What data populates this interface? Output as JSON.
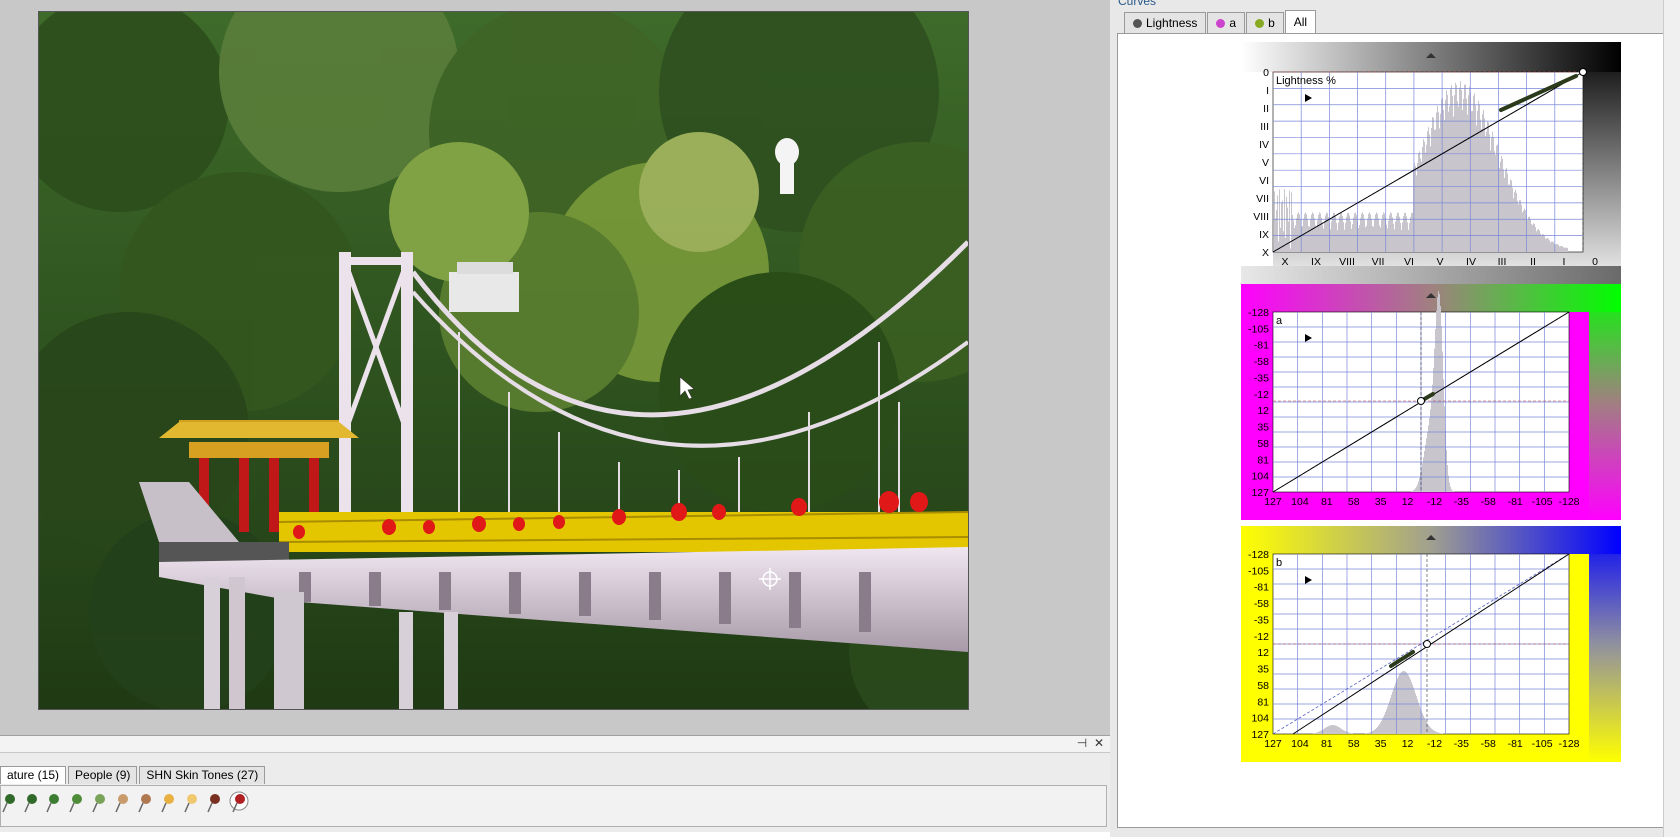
{
  "curves_panel": {
    "title": "Curves",
    "tabs": [
      {
        "label": "Lightness",
        "dot_color": "#555555",
        "active": false
      },
      {
        "label": "a",
        "dot_color": "#cc44cc",
        "active": false
      },
      {
        "label": "b",
        "dot_color": "#88aa22",
        "active": false
      },
      {
        "label": "All",
        "dot_color": "",
        "active": true
      }
    ],
    "lightness": {
      "channel_label": "Lightness %",
      "y_labels": [
        "0",
        "I",
        "II",
        "III",
        "IV",
        "V",
        "VI",
        "VII",
        "VIII",
        "IX",
        "X"
      ],
      "x_labels": [
        "X",
        "IX",
        "VIII",
        "VII",
        "VI",
        "V",
        "IV",
        "III",
        "II",
        "I",
        "0"
      ]
    },
    "a": {
      "channel_label": "a",
      "y_labels": [
        "-128",
        "-105",
        "-81",
        "-58",
        "-35",
        "-12",
        "12",
        "35",
        "58",
        "81",
        "104",
        "127"
      ],
      "x_labels": [
        "127",
        "104",
        "81",
        "58",
        "35",
        "12",
        "-12",
        "-35",
        "-58",
        "-81",
        "-105",
        "-128"
      ]
    },
    "b": {
      "channel_label": "b",
      "y_labels": [
        "-128",
        "-105",
        "-81",
        "-58",
        "-35",
        "-12",
        "12",
        "35",
        "58",
        "81",
        "104",
        "127"
      ],
      "x_labels": [
        "127",
        "104",
        "81",
        "58",
        "35",
        "12",
        "-12",
        "-35",
        "-58",
        "-81",
        "-105",
        "-128"
      ]
    }
  },
  "bottom_panel": {
    "pin_glyph": "⊣",
    "close_glyph": "✕",
    "preset_tabs": [
      {
        "label": "ature (15)",
        "active": true
      },
      {
        "label": "People (9)",
        "active": false
      },
      {
        "label": "SHN Skin Tones (27)",
        "active": false
      }
    ],
    "preset_pins": [
      "#2f6a2a",
      "#2f6a2a",
      "#3d7d33",
      "#4e8c3a",
      "#7aa35a",
      "#c99a6a",
      "#b07850",
      "#e8b040",
      "#f0c870",
      "#7a3020",
      "#b02020"
    ]
  }
}
